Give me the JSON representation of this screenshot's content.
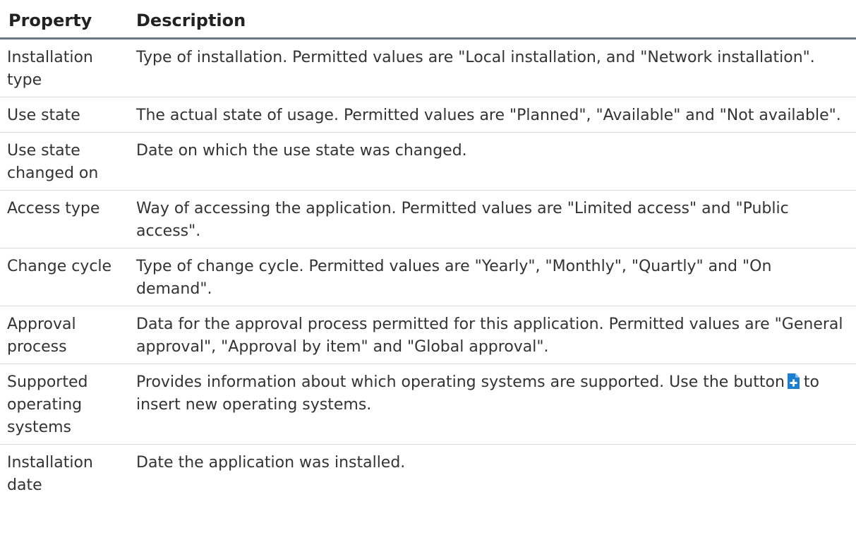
{
  "table": {
    "headers": {
      "property": "Property",
      "description": "Description"
    },
    "rows": [
      {
        "property": "Installation type",
        "description": "Type of installation. Permitted values are \"Local installation, and \"Network installation\"."
      },
      {
        "property": "Use state",
        "description": "The actual state of usage. Permitted values are \"Planned\", \"Available\" and \"Not available\"."
      },
      {
        "property": "Use state changed on",
        "description": "Date on which the use state was changed."
      },
      {
        "property": "Access type",
        "description": "Way of accessing the application. Permitted values are \"Limited access\" and \"Public access\"."
      },
      {
        "property": "Change cycle",
        "description": "Type of change cycle. Permitted values are \"Yearly\", \"Monthly\", \"Quartly\" and \"On demand\"."
      },
      {
        "property": "Approval process",
        "description": "Data for the approval process permitted for this application. Permitted values are \"General approval\", \"Approval by item\" and \"Global approval\"."
      },
      {
        "property": "Supported operating systems",
        "description_before_icon": "Provides information about which operating systems are supported. Use the button",
        "description_icon": "insert-plus-icon",
        "description_after_icon": "to insert new operating systems."
      },
      {
        "property": "Installation date",
        "description": "Date the application was installed."
      }
    ]
  },
  "colors": {
    "icon_blue": "#1a7fd1",
    "header_rule": "#6b7781",
    "row_rule": "#d9d9d9",
    "text": "#333333"
  }
}
